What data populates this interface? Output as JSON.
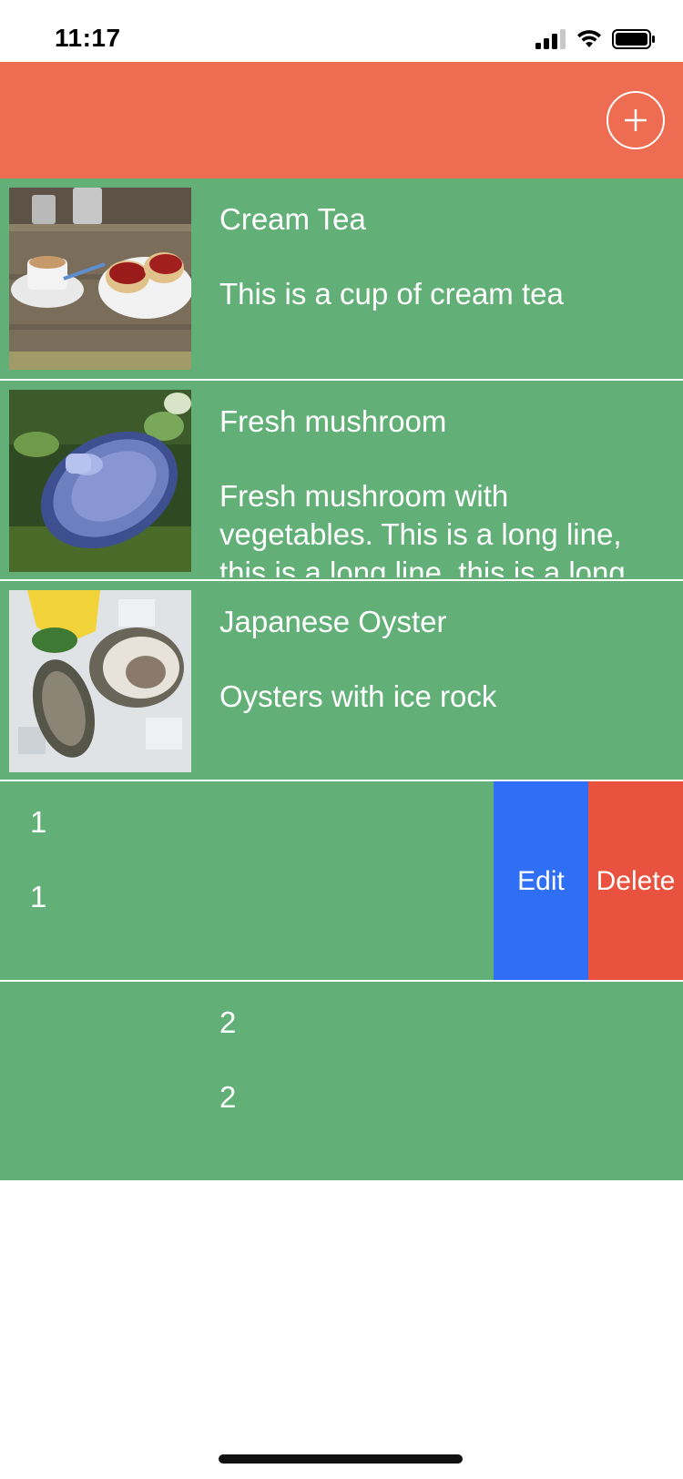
{
  "status_bar": {
    "time": "11:17",
    "icons": [
      "cellular-signal-icon",
      "wifi-icon",
      "battery-icon"
    ]
  },
  "nav_bar": {
    "background": "#ee6c51",
    "add_icon": "plus-circle-icon"
  },
  "list": {
    "row_color": "#62b077",
    "items": [
      {
        "title": "Cream Tea",
        "description": "This is a cup of cream tea",
        "image": "cream-tea-photo"
      },
      {
        "title": "Fresh mushroom",
        "description": "Fresh mushroom with vegetables. This is a long line, this is a long line, this is a long",
        "image": "mushroom-photo"
      },
      {
        "title": "Japanese Oyster",
        "description": "Oysters with ice rock",
        "image": "oyster-photo"
      },
      {
        "title": "1",
        "description": "1",
        "swiped": true,
        "actions": {
          "edit_label": "Edit",
          "delete_label": "Delete",
          "edit_color": "#2f6ff5",
          "delete_color": "#e8523f"
        }
      },
      {
        "title": "2",
        "description": "2"
      }
    ]
  }
}
